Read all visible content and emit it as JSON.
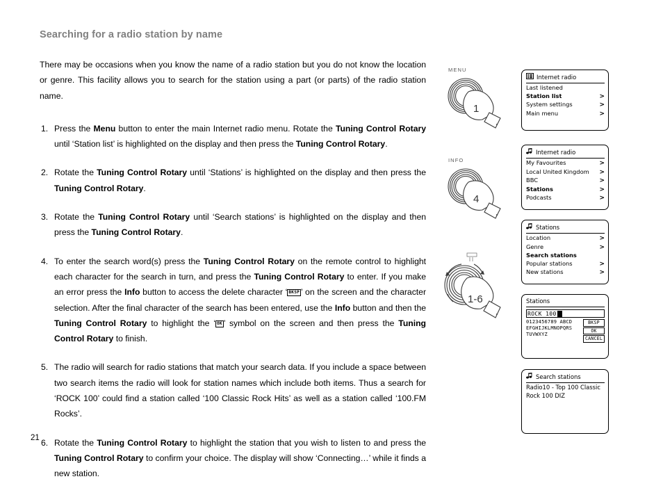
{
  "page": {
    "heading": "Searching for a radio station by name",
    "number": "21"
  },
  "body": {
    "intro": "There may be occasions when you know the name of a radio station but you do not know the location or genre. This facility allows you to search for the station using a part (or parts) of the radio station name.",
    "steps": [
      {
        "num": "1.",
        "parts": [
          {
            "t": "Press the ",
            "b": false
          },
          {
            "t": "Menu",
            "b": true
          },
          {
            "t": " button to enter the main Internet radio menu. Rotate the ",
            "b": false
          },
          {
            "t": "Tuning Control Rotary",
            "b": true
          },
          {
            "t": " until ‘Station list’ is highlighted on the display and then press the ",
            "b": false
          },
          {
            "t": "Tuning Control Rotary",
            "b": true
          },
          {
            "t": ".",
            "b": false
          }
        ]
      },
      {
        "num": "2.",
        "parts": [
          {
            "t": "Rotate the ",
            "b": false
          },
          {
            "t": "Tuning Control Rotary",
            "b": true
          },
          {
            "t": " until ‘Stations’ is highlighted on the display and then press the ",
            "b": false
          },
          {
            "t": "Tuning Control Rotary",
            "b": true
          },
          {
            "t": ".",
            "b": false
          }
        ]
      },
      {
        "num": "3.",
        "parts": [
          {
            "t": "Rotate the ",
            "b": false
          },
          {
            "t": "Tuning Control Rotary",
            "b": true
          },
          {
            "t": " until ‘Search stations’ is highlighted on the display and then press the ",
            "b": false
          },
          {
            "t": "Tuning Control Rotary",
            "b": true
          },
          {
            "t": ".",
            "b": false
          }
        ]
      },
      {
        "num": "4.",
        "parts": [
          {
            "t": "To enter the search word(s) press the ",
            "b": false
          },
          {
            "t": "Tuning Control Rotary",
            "b": true
          },
          {
            "t": " on the remote control to highlight each character for the search in turn, and press the ",
            "b": false
          },
          {
            "t": "Tuning Control Rotary",
            "b": true
          },
          {
            "t": " to enter. If you make an error press the ",
            "b": false
          },
          {
            "t": "Info",
            "b": true
          },
          {
            "t": " button to access the delete character ‘",
            "b": false
          },
          {
            "t": "BKSP",
            "b": false,
            "key": true
          },
          {
            "t": "’ on the screen and the character selection. After the final character of the search has been entered, use the ",
            "b": false
          },
          {
            "t": "Info",
            "b": true
          },
          {
            "t": " button and then the ",
            "b": false
          },
          {
            "t": "Tuning Control Rotary",
            "b": true
          },
          {
            "t": " to highlight the ‘",
            "b": false
          },
          {
            "t": "OK",
            "b": false,
            "key": true
          },
          {
            "t": "’ symbol on the screen and then press the ",
            "b": false
          },
          {
            "t": "Tuning Control Rotary",
            "b": true
          },
          {
            "t": " to finish.",
            "b": false
          }
        ]
      },
      {
        "num": "5.",
        "parts": [
          {
            "t": "The radio will search for radio stations that match your search data. If you include a space between two search items the radio will look for station names which include both items. Thus a search for ‘ROCK 100’ could find a station called ‘100 Classic Rock Hits’ as well as a station called ‘100.FM Rocks’.",
            "b": false
          }
        ]
      },
      {
        "num": "6.",
        "parts": [
          {
            "t": "Rotate the ",
            "b": false
          },
          {
            "t": "Tuning Control Rotary",
            "b": true
          },
          {
            "t": " to highlight the station that you wish to listen to and press the ",
            "b": false
          },
          {
            "t": "Tuning Control Rotary",
            "b": true
          },
          {
            "t": " to confirm your choice. The display will show ‘Connecting…’ while it finds a new station.",
            "b": false
          }
        ]
      }
    ]
  },
  "illustrations": [
    {
      "label": "MENU",
      "step": "1",
      "rotate": false
    },
    {
      "label": "INFO",
      "step": "4",
      "rotate": false
    },
    {
      "label": "",
      "step": "1-6",
      "rotate": true
    }
  ],
  "displays": [
    {
      "icon": "list-icon",
      "title": "Internet radio",
      "rows": [
        {
          "label": "Last listened",
          "chevron": "",
          "selected": false
        },
        {
          "label": "Station list",
          "chevron": ">",
          "selected": true
        },
        {
          "label": "System settings",
          "chevron": ">",
          "selected": false
        },
        {
          "label": "Main menu",
          "chevron": ">",
          "selected": false
        }
      ]
    },
    {
      "icon": "music-note-icon",
      "title": "Internet radio",
      "rows": [
        {
          "label": "My Favourites",
          "chevron": ">",
          "selected": false
        },
        {
          "label": "Local United Kingdom",
          "chevron": ">",
          "selected": false
        },
        {
          "label": "BBC",
          "chevron": ">",
          "selected": false
        },
        {
          "label": "Stations",
          "chevron": ">",
          "selected": true
        },
        {
          "label": "Podcasts",
          "chevron": ">",
          "selected": false
        }
      ]
    },
    {
      "icon": "music-note-icon",
      "title": "Stations",
      "rows": [
        {
          "label": "Location",
          "chevron": ">",
          "selected": false
        },
        {
          "label": "Genre",
          "chevron": ">",
          "selected": false
        },
        {
          "label": "Search stations",
          "chevron": "",
          "selected": true
        },
        {
          "label": "Popular stations",
          "chevron": ">",
          "selected": false
        },
        {
          "label": "New stations",
          "chevron": ">",
          "selected": false
        }
      ]
    }
  ],
  "entry_display": {
    "title": "Stations",
    "field_value": "ROCK 100",
    "charmap": "0123456789 ABCD\nEFGHIJKLMNOPQRS\nTUVWXYZ",
    "buttons": [
      "BKSP",
      "OK",
      "CANCEL"
    ]
  },
  "result_display": {
    "icon": "music-note-icon",
    "title": "Search stations",
    "lines": [
      "Radio10 - Top 100 Classic",
      "Rock 100 DIZ"
    ]
  },
  "colors": {
    "heading": "#808080",
    "text": "#000000",
    "panel_border": "#000000",
    "background": "#ffffff"
  }
}
